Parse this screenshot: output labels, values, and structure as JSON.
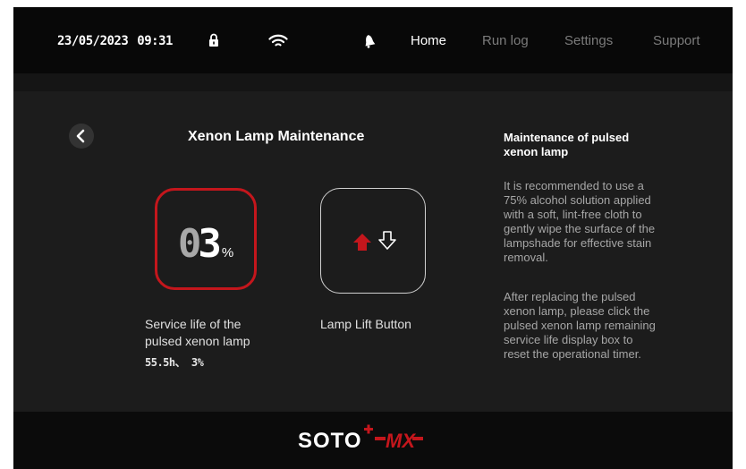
{
  "status": {
    "date": "23/05/2023",
    "time": "09:31",
    "icons": [
      "lock-icon",
      "wifi-icon",
      "bell-icon"
    ]
  },
  "nav": {
    "items": [
      {
        "label": "Home",
        "active": true
      },
      {
        "label": "Run log",
        "active": false
      },
      {
        "label": "Settings",
        "active": false
      },
      {
        "label": "Support",
        "active": false
      }
    ]
  },
  "page": {
    "title": "Xenon Lamp Maintenance",
    "back_icon": "chevron-left-icon"
  },
  "service_life": {
    "value_prefix": "0",
    "value_main": "3",
    "unit": "%",
    "label_line1": "Service life of the",
    "label_line2": "pulsed xenon lamp",
    "detail": "55.5h、 3%"
  },
  "lamp_lift": {
    "label": "Lamp Lift Button",
    "icons": [
      "arrow-up-icon",
      "arrow-down-icon"
    ]
  },
  "info": {
    "title_line1": "Maintenance of pulsed",
    "title_line2": "xenon lamp",
    "para1": [
      "It is recommended to use a",
      "75% alcohol solution applied",
      "with a soft, lint-free cloth to",
      "gently wipe the surface of the",
      "lampshade for effective stain",
      "removal."
    ],
    "para2": [
      "After replacing the pulsed",
      "xenon lamp, please click the",
      "pulsed xenon lamp remaining",
      "service life display box to",
      "reset the operational timer."
    ]
  },
  "footer": {
    "logo_text": "SOTO",
    "logo_suffix": "MX"
  },
  "colors": {
    "accent_red": "#c4161c",
    "background": "#1c1c1c",
    "topbar": "#080808"
  }
}
